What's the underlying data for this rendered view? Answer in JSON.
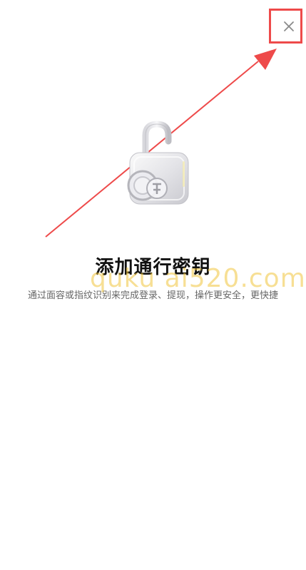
{
  "dialog": {
    "title": "添加通行密钥",
    "description": "通过面容或指纹识别来完成登录、提现，操作更安全，更快捷",
    "close_icon": "close-icon",
    "illustration_icon": "padlock-icon"
  },
  "watermark": {
    "text": "quku ai520.com"
  },
  "colors": {
    "annotation": "#ee4a4a",
    "title": "#111111",
    "description": "#666666",
    "close": "#8a8a8a",
    "watermark": "#f0c43c"
  }
}
